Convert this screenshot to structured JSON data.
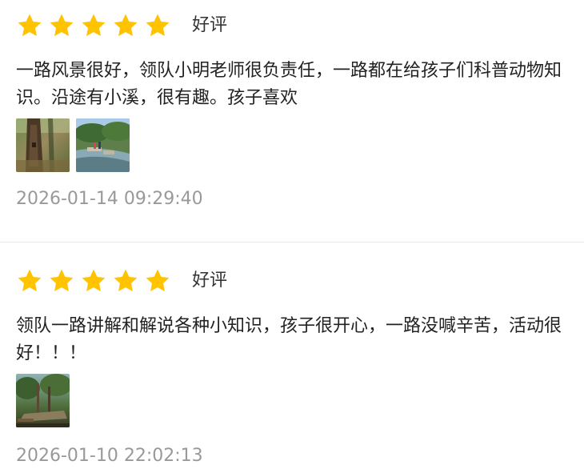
{
  "colors": {
    "star": "#FFC300",
    "timestamp": "#999999",
    "divider": "#E6E6E6"
  },
  "reviews": [
    {
      "rating": 5,
      "rating_label": "好评",
      "comment": "一路风景很好，领队小明老师很负责任，一路都在给孩子们科普动物知识。沿途有小溪，很有趣。孩子喜欢",
      "photo_count": 2,
      "timestamp": "2026-01-14 09:29:40"
    },
    {
      "rating": 5,
      "rating_label": "好评",
      "comment": "领队一路讲解和解说各种小知识，孩子很开心，一路没喊辛苦，活动很好！！！",
      "photo_count": 1,
      "timestamp": "2026-01-10 22:02:13"
    }
  ]
}
